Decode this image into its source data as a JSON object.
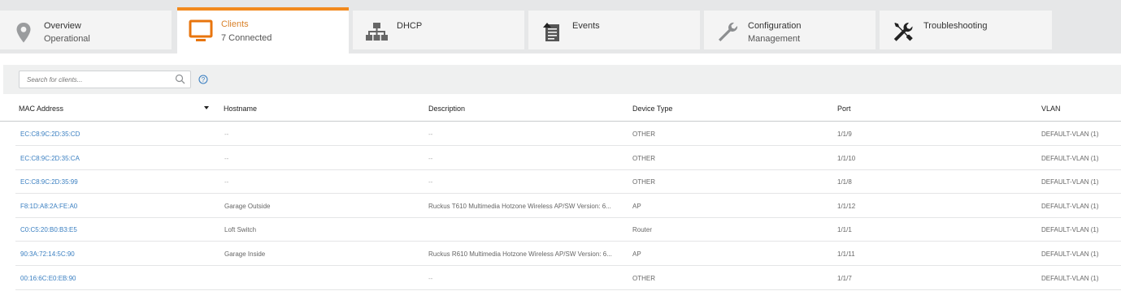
{
  "tabs": [
    {
      "name": "overview",
      "line1": "Overview",
      "line2": "Operational",
      "icon": "location-pin-icon"
    },
    {
      "name": "clients",
      "line1": "Clients",
      "line2": "7 Connected",
      "icon": "monitor-icon",
      "active": true
    },
    {
      "name": "dhcp",
      "line1": "DHCP",
      "line2": "",
      "icon": "network-tree-icon"
    },
    {
      "name": "events",
      "line1": "Events",
      "line2": "",
      "icon": "event-log-icon"
    },
    {
      "name": "configuration",
      "line1": "Configuration",
      "line2": "Management",
      "icon": "wrench-icon"
    },
    {
      "name": "troubleshooting",
      "line1": "Troubleshooting",
      "line2": "",
      "icon": "tools-icon"
    }
  ],
  "accent_color": "#f28a1e",
  "link_color": "#3a7fc1",
  "search": {
    "placeholder": "Search for clients...",
    "icon": "search-icon",
    "help_icon": "info-icon"
  },
  "columns": {
    "mac": "MAC Address",
    "hostname": "Hostname",
    "description": "Description",
    "device_type": "Device Type",
    "port": "Port",
    "vlan": "VLAN"
  },
  "rows": [
    {
      "mac": "EC:C8:9C:2D:35:CD",
      "hostname": "--",
      "description": "--",
      "device_type": "OTHER",
      "port": "1/1/9",
      "vlan": "DEFAULT-VLAN (1)"
    },
    {
      "mac": "EC:C8:9C:2D:35:CA",
      "hostname": "--",
      "description": "--",
      "device_type": "OTHER",
      "port": "1/1/10",
      "vlan": "DEFAULT-VLAN (1)"
    },
    {
      "mac": "EC:C8:9C:2D:35:99",
      "hostname": "--",
      "description": "--",
      "device_type": "OTHER",
      "port": "1/1/8",
      "vlan": "DEFAULT-VLAN (1)"
    },
    {
      "mac": "F8:1D:A8:2A:FE:A0",
      "hostname": "Garage Outside",
      "description": "Ruckus T610 Multimedia Hotzone Wireless AP/SW Version: 6...",
      "device_type": "AP",
      "port": "1/1/12",
      "vlan": "DEFAULT-VLAN (1)"
    },
    {
      "mac": "C0:C5:20:B0:B3:E5",
      "hostname": "Loft Switch",
      "description": "",
      "device_type": "Router",
      "port": "1/1/1",
      "vlan": "DEFAULT-VLAN (1)"
    },
    {
      "mac": "90:3A:72:14:5C:90",
      "hostname": "Garage Inside",
      "description": "Ruckus R610 Multimedia Hotzone Wireless AP/SW Version: 6...",
      "device_type": "AP",
      "port": "1/1/11",
      "vlan": "DEFAULT-VLAN (1)"
    },
    {
      "mac": "00:16:6C:E0:EB:90",
      "hostname": "",
      "description": "--",
      "device_type": "OTHER",
      "port": "1/1/7",
      "vlan": "DEFAULT-VLAN (1)"
    }
  ]
}
